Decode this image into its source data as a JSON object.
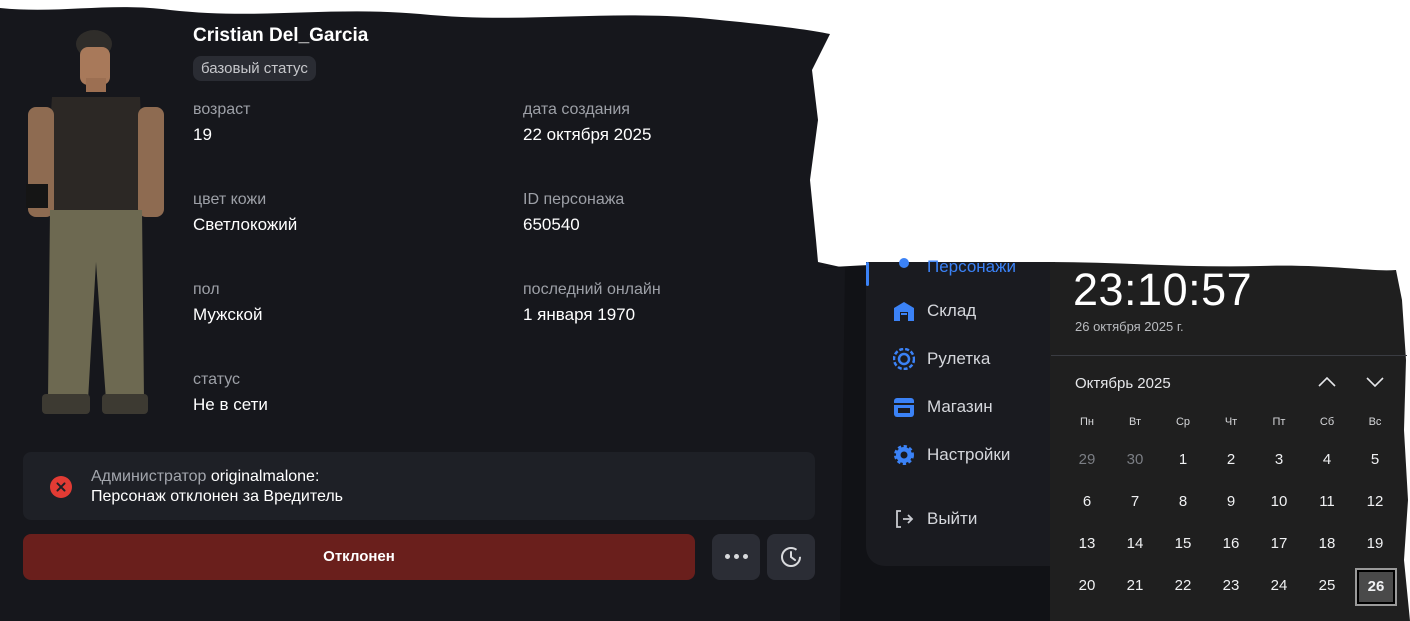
{
  "character": {
    "name": "Cristian Del_Garcia",
    "badge": "базовый статус",
    "fields": [
      {
        "label": "возраст",
        "value": "19"
      },
      {
        "label": "дата создания",
        "value": "22 октября 2025"
      },
      {
        "label": "цвет кожи",
        "value": "Светлокожий"
      },
      {
        "label": "ID персонажа",
        "value": "650540"
      },
      {
        "label": "пол",
        "value": "Мужской"
      },
      {
        "label": "последний онлайн",
        "value": "1 января 1970"
      },
      {
        "label": "статус",
        "value": "Не в сети"
      }
    ]
  },
  "notice": {
    "role": "Администратор",
    "author": "originalmalone:",
    "message": "Персонаж отклонен за Вредитель"
  },
  "actions": {
    "reject_label": "Отклонен",
    "more_icon": "more-dots-icon",
    "history_icon": "history-clock-icon"
  },
  "sidebar": {
    "items": [
      {
        "label": "Персонажи",
        "icon": "user-icon",
        "active": true
      },
      {
        "label": "Склад",
        "icon": "warehouse-icon"
      },
      {
        "label": "Рулетка",
        "icon": "roulette-icon"
      },
      {
        "label": "Магазин",
        "icon": "store-icon"
      },
      {
        "label": "Настройки",
        "icon": "gear-icon"
      },
      {
        "label": "Выйти",
        "icon": "logout-icon"
      }
    ]
  },
  "clock": {
    "time": "23:10:57",
    "date": "26 октября 2025 г."
  },
  "calendar": {
    "month_label": "Октябрь 2025",
    "weekdays": [
      "Пн",
      "Вт",
      "Ср",
      "Чт",
      "Пт",
      "Сб",
      "Вс"
    ],
    "weeks": [
      [
        "29",
        "30",
        "1",
        "2",
        "3",
        "4",
        "5"
      ],
      [
        "6",
        "7",
        "8",
        "9",
        "10",
        "11",
        "12"
      ],
      [
        "13",
        "14",
        "15",
        "16",
        "17",
        "18",
        "19"
      ],
      [
        "20",
        "21",
        "22",
        "23",
        "24",
        "25",
        "26"
      ]
    ],
    "muted_days": [
      "29",
      "30"
    ],
    "today": "26"
  },
  "colors": {
    "card_bg": "#16171c",
    "sidebar_bg": "#1a1b20",
    "calendar_bg": "#1f1f1f",
    "reject_bg": "#6a1f1c",
    "accent": "#3b82f6",
    "error": "#e23b34"
  }
}
